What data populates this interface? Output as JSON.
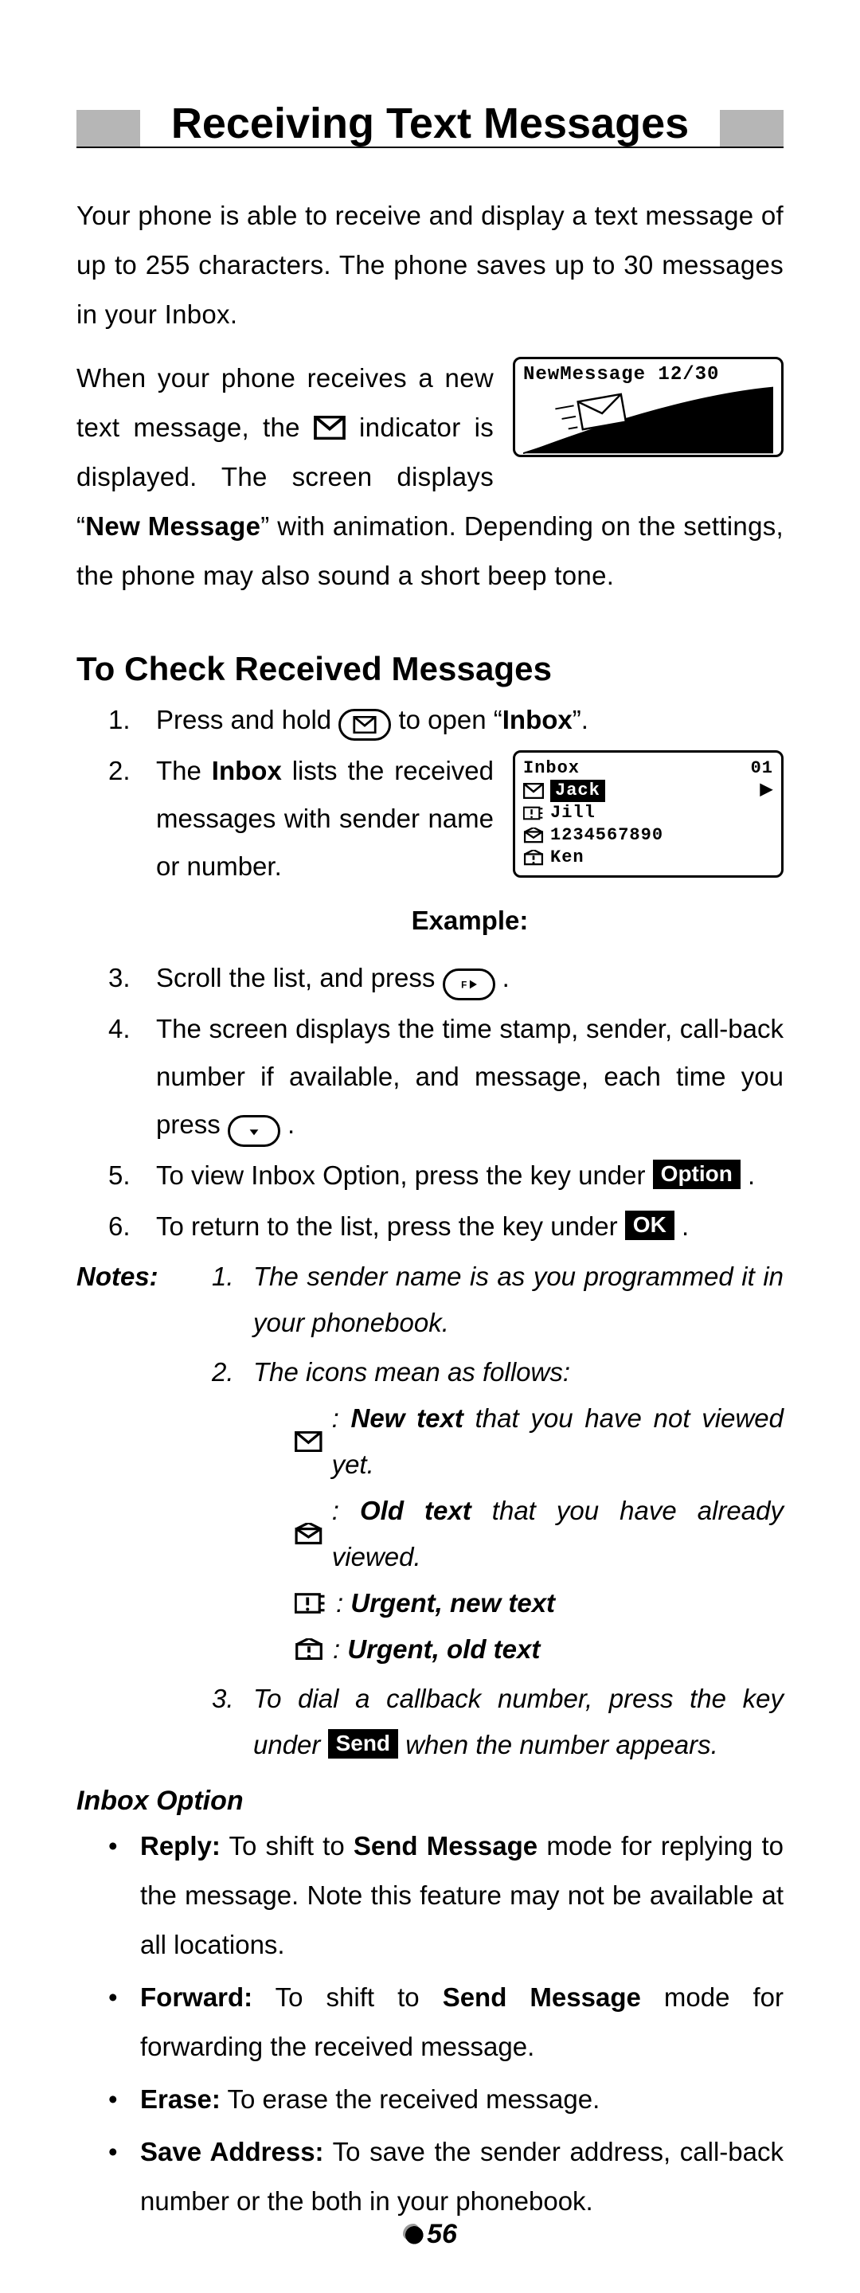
{
  "title": "Receiving Text Messages",
  "intro_p1": "Your phone is able to receive and display a text message of up to 255 characters. The phone saves up to 30 messages in your Inbox.",
  "intro_p2_before": "When your phone receives a new text message, the ",
  "intro_p2_after_icon": " indicator is displayed. The screen displays “",
  "intro_p2_newmsg_bold": "New Message",
  "intro_p2_closequote": "” with animation. Depending on the settings, the phone may also sound a short beep tone.",
  "lcd_newmessage": {
    "title": "NewMessage 12/30"
  },
  "section_check": "To Check Received Messages",
  "steps": {
    "s1_before": "Press and hold ",
    "s1_after": " to open “",
    "s1_inbox_bold": "Inbox",
    "s1_close": "”.",
    "s2_before": "The ",
    "s2_inbox_bold": "Inbox",
    "s2_after": " lists the received messages with sender name or number.",
    "s2_example_label": "Example:",
    "s3_before": "Scroll the list, and press ",
    "s3_after": ".",
    "s4": "The screen displays the time stamp, sender, call-back number if available, and message, each time you press ",
    "s4_after": ".",
    "s5_before": "To view Inbox Option, press the key under ",
    "s5_after": " .",
    "s6_before": "To return to the list, press the key under ",
    "s6_after": " ."
  },
  "lcd_inbox": {
    "title_left": "Inbox",
    "title_right": "01",
    "rows": [
      "Jack",
      "Jill",
      "1234567890",
      "Ken"
    ]
  },
  "key_labels": {
    "option": "Option",
    "ok": "OK",
    "send": "Send"
  },
  "notes_label": "Notes:",
  "notes": {
    "n1": "The sender name is as you programmed it in your phonebook.",
    "n2_lead": "The icons mean as follows:",
    "icon_new_b": "New text",
    "icon_new_rest": " that you have not viewed yet.",
    "icon_old_b": "Old text",
    "icon_old_rest": " that you have already viewed.",
    "icon_urg_new": "Urgent, new text",
    "icon_urg_old": "Urgent, old text",
    "n3_before": "To dial a callback number, press the key under ",
    "n3_after": " when the number appears."
  },
  "inbox_option_heading": "Inbox Option",
  "inbox_option": {
    "reply_b": "Reply:",
    "reply_txt_1": " To shift to ",
    "reply_sendmsg": "Send Message",
    "reply_txt_2": " mode for replying to the message. Note this feature may not be available at all locations.",
    "forward_b": "Forward:",
    "forward_txt_1": " To shift to ",
    "forward_sendmsg": "Send Message",
    "forward_txt_2": " mode for forwarding the received message.",
    "erase_b": "Erase:",
    "erase_txt": " To erase the received message.",
    "save_b": "Save Address:",
    "save_txt": " To save the sender address, call-back number or the both in your phonebook."
  },
  "page_number": "56"
}
